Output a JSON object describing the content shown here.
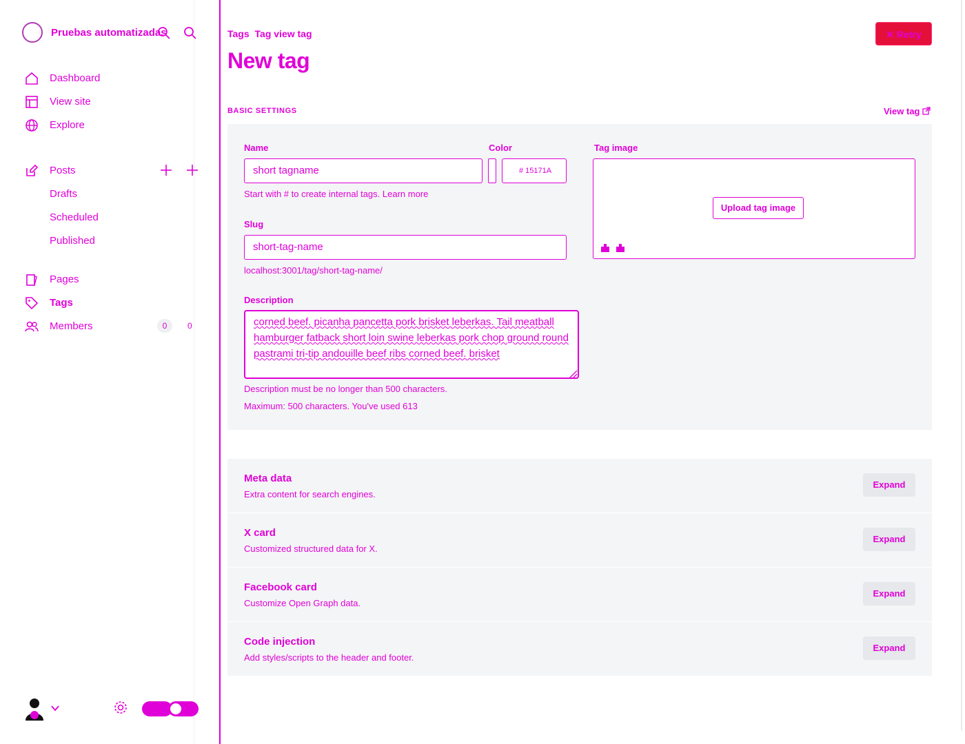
{
  "brand": {
    "name": "Pruebas automatizadas"
  },
  "nav": {
    "dashboard": "Dashboard",
    "view_site": "View site",
    "explore": "Explore",
    "posts": "Posts",
    "drafts": "Drafts",
    "scheduled": "Scheduled",
    "published": "Published",
    "pages": "Pages",
    "tags": "Tags",
    "members": "Members",
    "members_count": "0",
    "members_count_b": "0"
  },
  "breadcrumb": {
    "parent": "Tags",
    "current": "Tag view tag"
  },
  "page": {
    "title": "New tag"
  },
  "header": {
    "retry_label": "Retry"
  },
  "basic": {
    "section_label": "BASIC SETTINGS",
    "view_tag_label": "View tag",
    "name_label": "Name",
    "name_value": "short tagname",
    "name_hint": "Start with # to create internal tags. Learn more",
    "color_label": "Color",
    "color_value": "# 15171A",
    "image_label": "Tag image",
    "upload_label": "Upload tag image",
    "slug_label": "Slug",
    "slug_value": "short-tag-name",
    "slug_url": "localhost:3001/tag/short-tag-name/",
    "description_label": "Description",
    "description_value": "corned beef. picanha pancetta pork brisket leberkas. Tail meatball hamburger fatback short loin swine leberkas pork chop ground round pastrami tri-tip andouille beef ribs corned beef. brisket",
    "description_hint": "Description must be no longer than 500 characters.",
    "description_max": "Maximum: 500 characters. You've used 613"
  },
  "sections": [
    {
      "title": "Meta data",
      "desc": "Extra content for search engines.",
      "button": "Expand"
    },
    {
      "title": "X card",
      "desc": "Customized structured data for X.",
      "button": "Expand"
    },
    {
      "title": "Facebook card",
      "desc": "Customize Open Graph data.",
      "button": "Expand"
    },
    {
      "title": "Code injection",
      "desc": "Add styles/scripts to the header and footer.",
      "button": "Expand"
    }
  ],
  "colors": {
    "accent": "#e000d8",
    "danger": "#e5103a",
    "panel": "#f4f5f6"
  }
}
